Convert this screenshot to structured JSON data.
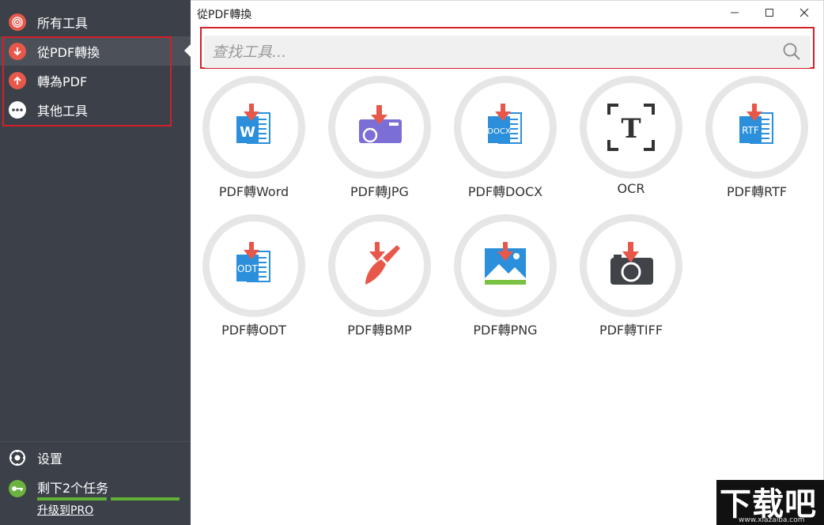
{
  "window": {
    "title": "從PDF轉換",
    "minimize_label": "—",
    "maximize_label": "☐",
    "close_label": "✕"
  },
  "sidebar": {
    "items": [
      {
        "label": "所有工具",
        "icon": "spiral-icon",
        "active": false
      },
      {
        "label": "從PDF轉換",
        "icon": "arrow-down-icon",
        "active": true
      },
      {
        "label": "轉為PDF",
        "icon": "arrow-up-icon",
        "active": false
      },
      {
        "label": "其他工具",
        "icon": "more-icon",
        "active": false
      }
    ],
    "settings_label": "设置",
    "tasks_label": "剩下2个任务",
    "tasks_remaining": 2,
    "upgrade_label": "升级到PRO"
  },
  "search": {
    "placeholder": "查找工具..."
  },
  "tools": [
    {
      "label": "PDF轉Word",
      "icon": "word-doc-icon"
    },
    {
      "label": "PDF轉JPG",
      "icon": "jpg-camera-icon"
    },
    {
      "label": "PDF轉DOCX",
      "icon": "docx-doc-icon"
    },
    {
      "label": "OCR",
      "icon": "ocr-text-icon"
    },
    {
      "label": "PDF轉RTF",
      "icon": "rtf-doc-icon"
    },
    {
      "label": "PDF轉ODT",
      "icon": "odt-doc-icon"
    },
    {
      "label": "PDF轉BMP",
      "icon": "paint-brush-icon"
    },
    {
      "label": "PDF轉PNG",
      "icon": "image-icon"
    },
    {
      "label": "PDF轉TIFF",
      "icon": "camera-icon"
    }
  ],
  "doc_badges": {
    "word": "W",
    "docx": "DOCX",
    "rtf": "RTF",
    "odt": "ODT",
    "ocr": "T"
  },
  "watermark": {
    "big": "下载吧",
    "small": "www.xiazaiba.com"
  },
  "colors": {
    "sidebar_bg": "#3b4049",
    "accent_red": "#e8584a",
    "doc_blue": "#2b8fdb",
    "progress_green": "#5fb034",
    "highlight_border": "#d61f26"
  }
}
